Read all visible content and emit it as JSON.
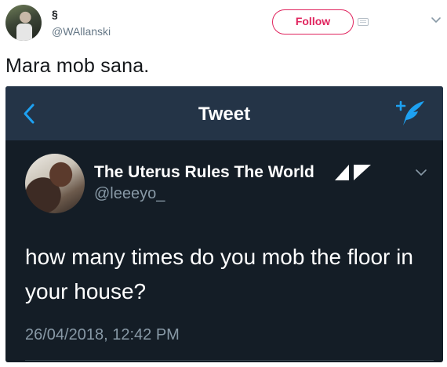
{
  "outer_tweet": {
    "author_name": "§",
    "handle": "@WAllanski",
    "follow_label": "Follow",
    "text": "Mara mob sana."
  },
  "embedded_screenshot": {
    "nav_title": "Tweet",
    "author_name": "The Uterus Rules The World",
    "handle": "@leeeyo_",
    "text": "how many times do you mob the floor in your house?",
    "timestamp": "26/04/2018, 12:42 PM"
  },
  "icons": {
    "outer_caret": "chevron-down-icon",
    "card": "card-icon",
    "back": "back-chevron-icon",
    "compose": "compose-tweet-icon",
    "logo": "triangle-logo-icon",
    "inner_caret": "chevron-down-icon"
  },
  "colors": {
    "follow_accent": "#e0245e",
    "dark_bg": "#141d26",
    "dark_nav": "#243447",
    "twitter_blue": "#1da1f2",
    "muted_text": "#8899a6",
    "handle_gray": "#657786"
  }
}
